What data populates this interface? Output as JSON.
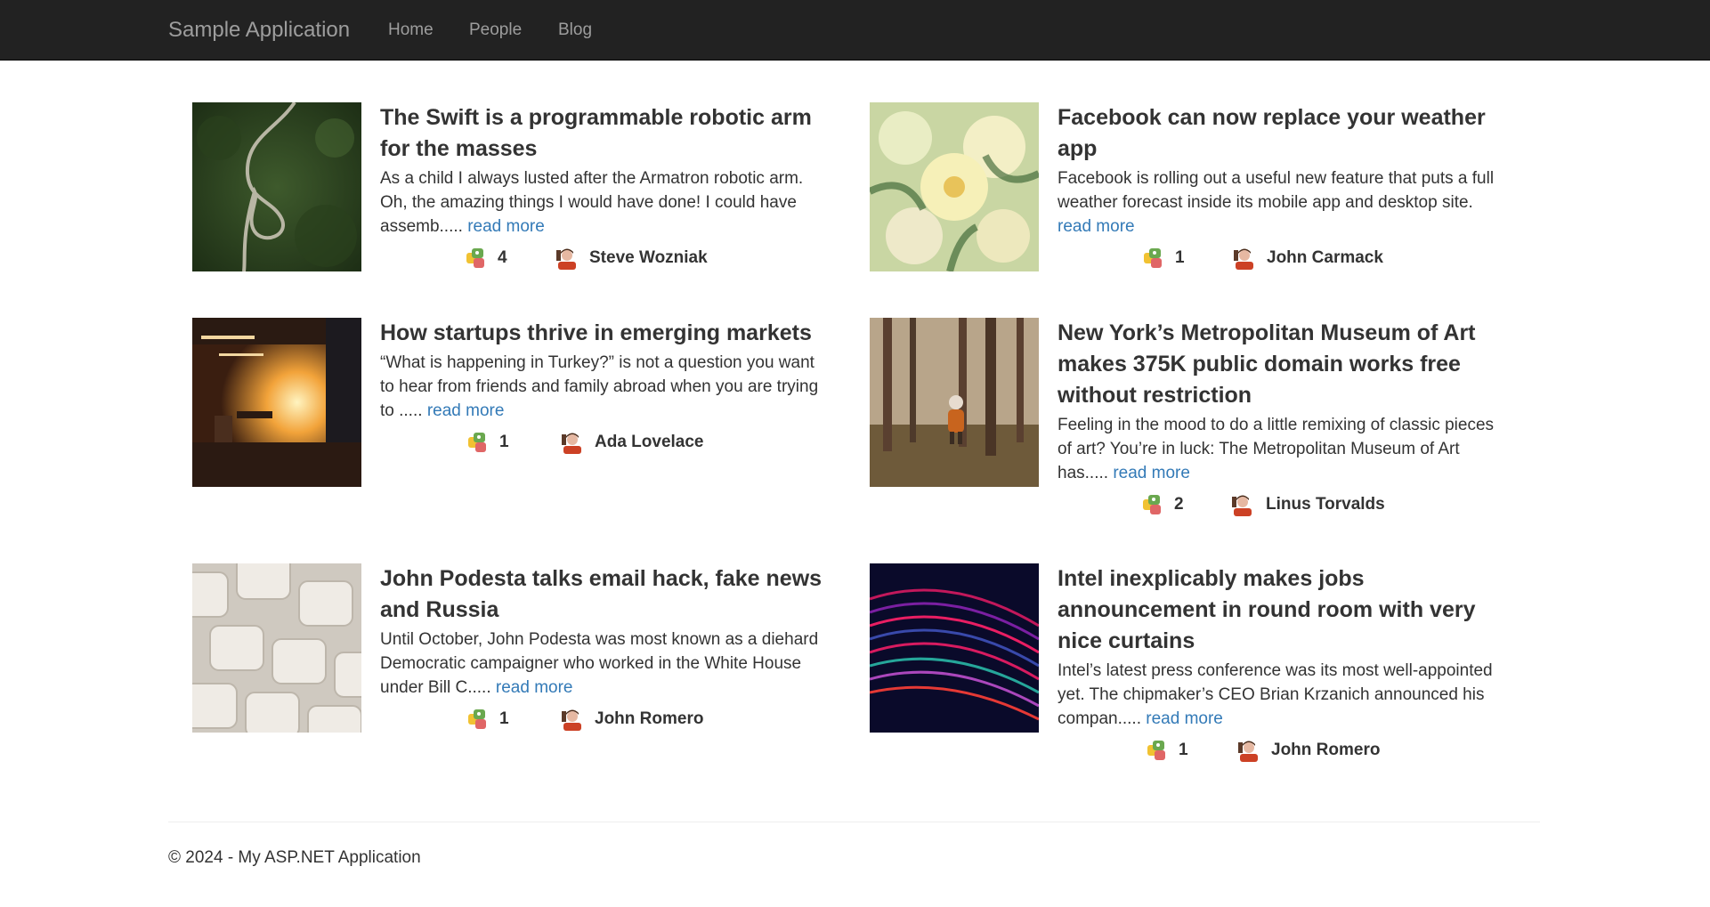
{
  "navbar": {
    "brand": "Sample Application",
    "links": [
      {
        "label": "Home"
      },
      {
        "label": "People"
      },
      {
        "label": "Blog"
      }
    ]
  },
  "posts": [
    {
      "title": "The Swift is a programmable robotic arm for the masses",
      "excerpt": "As a child I always lusted after the Armatron robotic arm. Oh, the amazing things I would have done! I could have assemb.....",
      "read_more": "read more",
      "comments": "4",
      "author": "Steve Wozniak",
      "thumb_icon": "forest-road-image"
    },
    {
      "title": "Facebook can now replace your weather app",
      "excerpt": "Facebook is rolling out a useful new feature that puts a full weather forecast inside its mobile app and desktop site.",
      "read_more": "read more",
      "comments": "1",
      "author": "John Carmack",
      "thumb_icon": "flowers-image"
    },
    {
      "title": "How startups thrive in emerging markets",
      "excerpt": "“What is happening in Turkey?” is not a question you want to hear from friends and family abroad when you are trying to .....",
      "read_more": "read more",
      "comments": "1",
      "author": "Ada Lovelace",
      "thumb_icon": "train-station-image"
    },
    {
      "title": "New York’s Metropolitan Museum of Art makes 375K public domain works free without restriction",
      "excerpt": "Feeling in the mood to do a little remixing of classic pieces of art? You’re in luck: The Metropolitan Museum of Art has.....",
      "read_more": "read more",
      "comments": "2",
      "author": "Linus Torvalds",
      "thumb_icon": "forest-child-image"
    },
    {
      "title": "John Podesta talks email hack, fake news and Russia",
      "excerpt": "Until October, John Podesta was most known as a diehard Democratic campaigner who worked in the White House under Bill C.....",
      "read_more": "read more",
      "comments": "1",
      "author": "John Romero",
      "thumb_icon": "white-tiles-image"
    },
    {
      "title": "Intel inexplicably makes jobs announcement in round room with very nice curtains",
      "excerpt": "Intel’s latest press conference was its most well-appointed yet. The chipmaker’s CEO Brian Krzanich announced his compan.....",
      "read_more": "read more",
      "comments": "1",
      "author": "John Romero",
      "thumb_icon": "light-streaks-image"
    }
  ],
  "footer": {
    "text": "© 2024 - My ASP.NET Application"
  },
  "colors": {
    "navbar_bg": "#222222",
    "nav_text": "#9d9d9d",
    "link": "#337ab7",
    "text": "#333333"
  }
}
